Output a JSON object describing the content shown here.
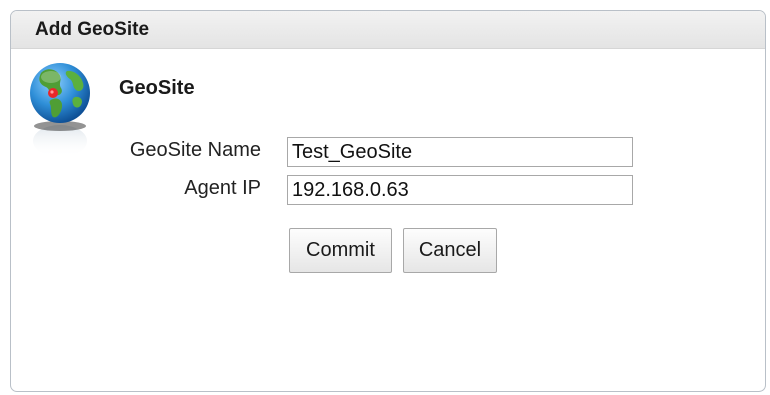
{
  "dialog": {
    "title": "Add GeoSite",
    "section_title": "GeoSite",
    "icon": "globe-icon"
  },
  "form": {
    "geosite_name": {
      "label": "GeoSite Name",
      "value": "Test_GeoSite"
    },
    "agent_ip": {
      "label": "Agent IP",
      "value": "192.168.0.63"
    }
  },
  "buttons": {
    "commit_label": "Commit",
    "cancel_label": "Cancel"
  },
  "colors": {
    "globe_ocean": "#2f8fd8",
    "globe_land": "#55a83a",
    "globe_marker": "#e8262a"
  }
}
